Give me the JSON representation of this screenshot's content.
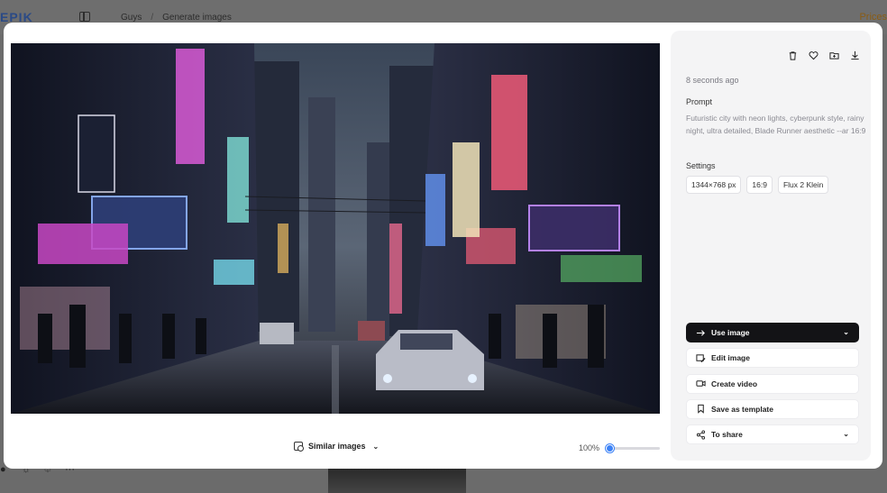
{
  "background": {
    "logo": "EPIK",
    "breadcrumbs": [
      "Guys",
      "Generate images"
    ],
    "breadcrumb_sep": "/",
    "right_link": "Prices"
  },
  "modal": {
    "image_alt_icon": "image-icon",
    "similar_label": "Similar images",
    "zoom_label": "100%",
    "zoom_level": 0
  },
  "panel": {
    "timestamp": "8 seconds ago",
    "prompt_heading": "Prompt",
    "prompt_text": "Futuristic city with neon lights, cyberpunk style, rainy night, ultra detailed, Blade Runner aesthetic --ar 16:9",
    "settings_heading": "Settings",
    "settings": [
      "1344×768 px",
      "16:9",
      "Flux 2 Klein"
    ],
    "tools": [
      "trash-icon",
      "heart-icon",
      "folder-icon",
      "download-icon"
    ],
    "actions": [
      {
        "label": "Use image",
        "icon": "arrow-right-icon",
        "dropdown": true,
        "primary": true
      },
      {
        "label": "Edit image",
        "icon": "edit-image-icon",
        "dropdown": false,
        "primary": false
      },
      {
        "label": "Create video",
        "icon": "video-icon",
        "dropdown": false,
        "primary": false
      },
      {
        "label": "Save as template",
        "icon": "bookmark-icon",
        "dropdown": false,
        "primary": false
      },
      {
        "label": "To share",
        "icon": "share-icon",
        "dropdown": true,
        "primary": false
      }
    ]
  },
  "colors": {
    "accent": "#3c82f6",
    "primary_button": "#131316",
    "panel_bg": "#f4f4f5"
  }
}
